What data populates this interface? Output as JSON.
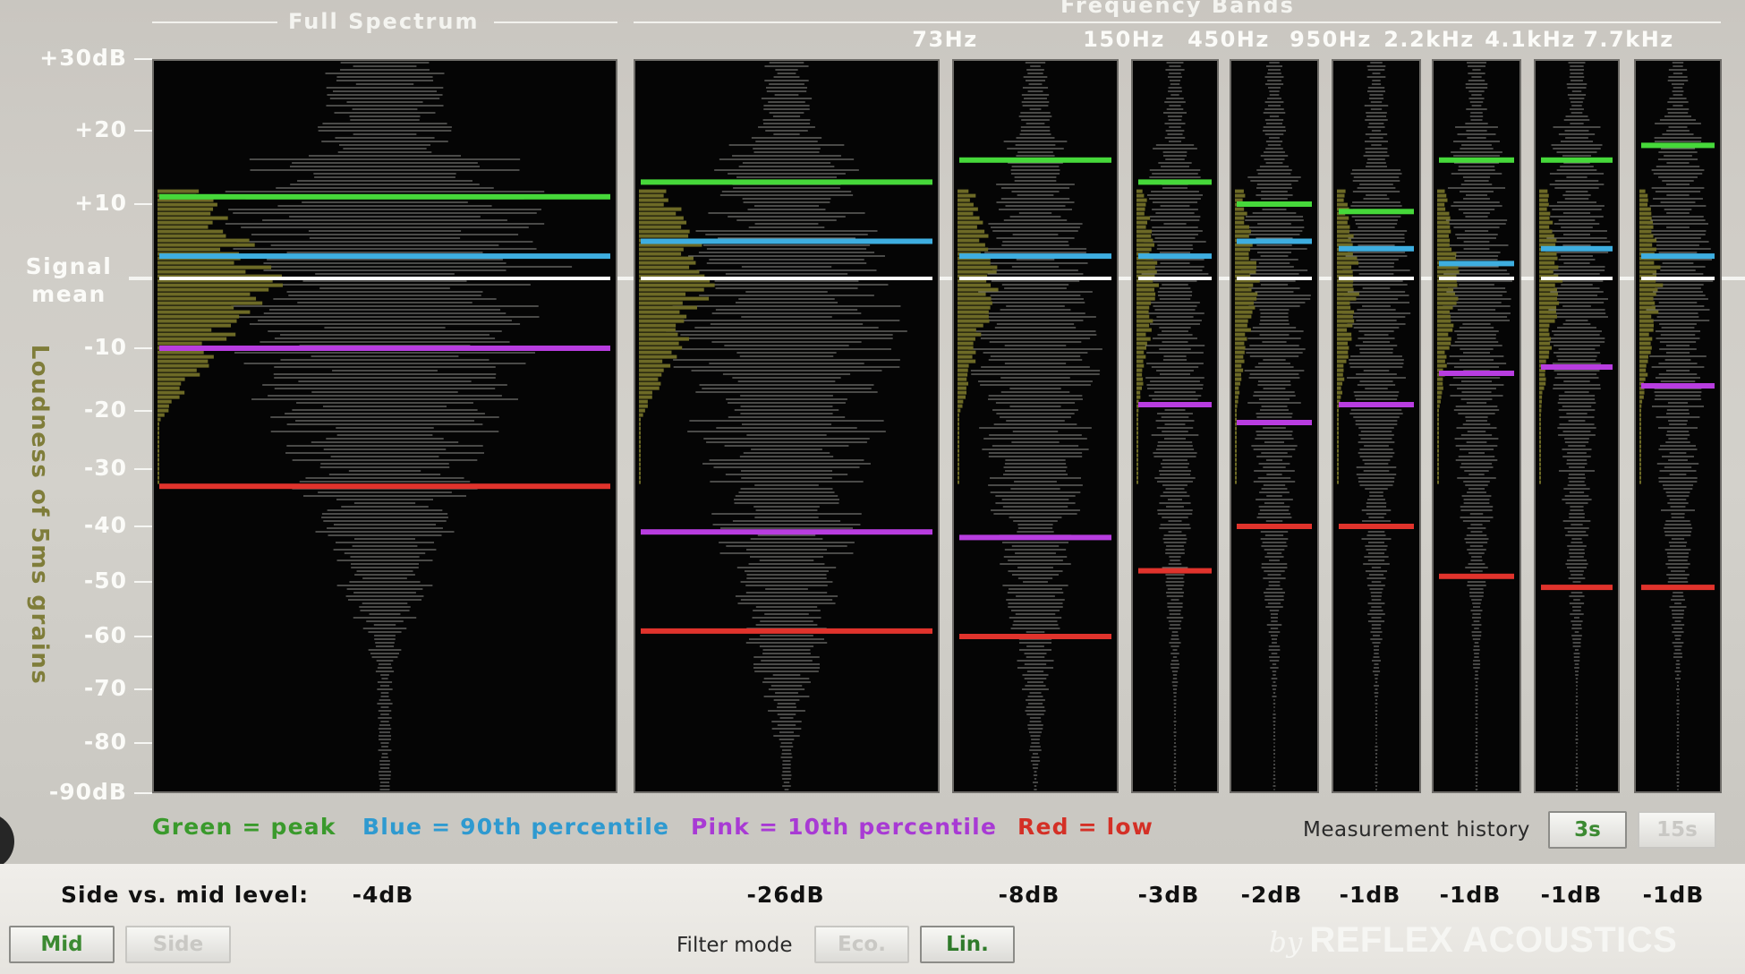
{
  "headers": {
    "full_spectrum": "Full Spectrum",
    "frequency_bands": "Frequency Bands",
    "band_freqs": [
      "73Hz",
      "150Hz",
      "450Hz",
      "950Hz",
      "2.2kHz",
      "4.1kHz",
      "7.7kHz"
    ]
  },
  "axis": {
    "title": "Loudness of 5ms grains",
    "signal_mean_line1": "Signal",
    "signal_mean_line2": "mean",
    "ticks": [
      {
        "label": "+30dB",
        "value": 30
      },
      {
        "label": "+20",
        "value": 20
      },
      {
        "label": "+10",
        "value": 10
      },
      {
        "label": "-10",
        "value": -10
      },
      {
        "label": "-20",
        "value": -20
      },
      {
        "label": "-30",
        "value": -30
      },
      {
        "label": "-40",
        "value": -40
      },
      {
        "label": "-50",
        "value": -50
      },
      {
        "label": "-60",
        "value": -60
      },
      {
        "label": "-70",
        "value": -70
      },
      {
        "label": "-80",
        "value": -80
      },
      {
        "label": "-90dB",
        "value": -90
      }
    ]
  },
  "colors": {
    "peak": "#46d83a",
    "p90": "#3eaee0",
    "p10": "#b83de0",
    "low": "#e0332c",
    "mean": "#ffffff",
    "histogram": "#6d6a26",
    "grains": "#9a9a96"
  },
  "bands": [
    {
      "id": "full",
      "peak": 11,
      "p90": 3,
      "p10": -10,
      "low": -33
    },
    {
      "id": "73hz",
      "peak": 13,
      "p90": 5,
      "p10": -41,
      "low": -59
    },
    {
      "id": "150hz",
      "peak": 16,
      "p90": 3,
      "p10": -42,
      "low": -60
    },
    {
      "id": "450hz",
      "peak": 13,
      "p90": 3,
      "p10": -19,
      "low": -48
    },
    {
      "id": "950hz",
      "peak": 10,
      "p90": 5,
      "p10": -22,
      "low": -40
    },
    {
      "id": "2.2khz",
      "peak": 9,
      "p90": 4,
      "p10": -19,
      "low": -40
    },
    {
      "id": "4.1khz",
      "peak": 16,
      "p90": 2,
      "p10": -14,
      "low": -49
    },
    {
      "id": "7.7khz",
      "peak": 16,
      "p90": 4,
      "p10": -13,
      "low": -51
    },
    {
      "id": "extra",
      "peak": 18,
      "p90": 3,
      "p10": -16,
      "low": -51
    }
  ],
  "legend": {
    "green": "Green = peak",
    "blue": "Blue = 90th percentile",
    "pink": "Pink = 10th percentile",
    "red": "Red = low",
    "history_label": "Measurement history",
    "history_3s": "3s",
    "history_15s": "15s"
  },
  "levels": {
    "label": "Side vs. mid level:",
    "values": [
      "-4dB",
      "-26dB",
      "-8dB",
      "-3dB",
      "-2dB",
      "-1dB",
      "-1dB",
      "-1dB",
      "-1dB"
    ]
  },
  "controls": {
    "mid": "Mid",
    "side": "Side",
    "filter_mode": "Filter mode",
    "eco": "Eco.",
    "lin": "Lin."
  },
  "brand": {
    "by": "by",
    "name": "REFLEX ACOUSTICS"
  }
}
